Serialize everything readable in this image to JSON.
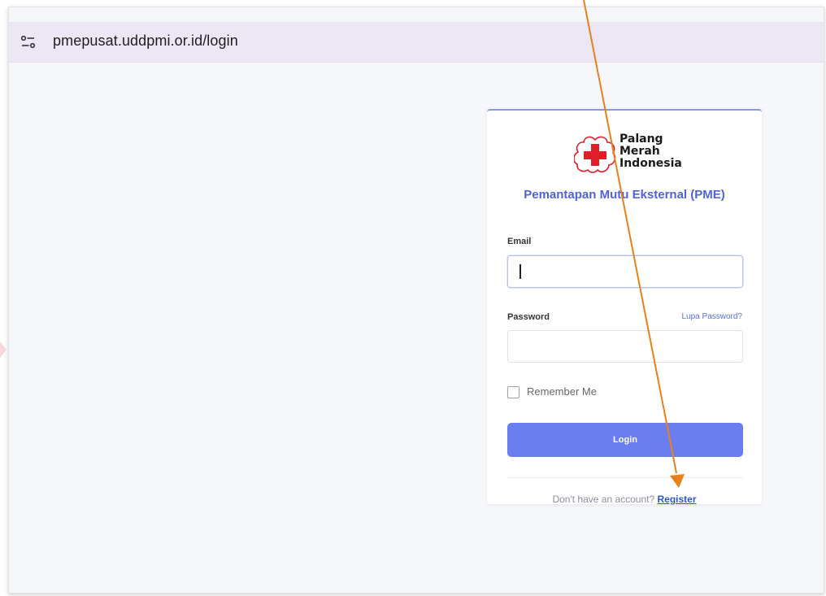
{
  "browser": {
    "url": "pmepusat.uddpmi.or.id/login",
    "icon": "tune-icon"
  },
  "logo": {
    "line1": "Palang",
    "line2": "Merah",
    "line3": "Indonesia",
    "icon": "red-cross-flower-icon",
    "color": "#e11d2a"
  },
  "form": {
    "app_title": "Pemantapan Mutu Eksternal (PME)",
    "email_label": "Email",
    "email_value": "",
    "password_label": "Password",
    "password_value": "",
    "forgot_label": "Lupa Password?",
    "remember_label": "Remember Me",
    "remember_checked": false,
    "login_label": "Login",
    "register_prompt": "Don't have an account? ",
    "register_label": "Register"
  },
  "colors": {
    "accent": "#6b7ef0",
    "title": "#4f63d6",
    "annotation_arrow": "#e8801c",
    "address_bar": "#ede6f4"
  },
  "annotation": {
    "type": "arrow",
    "target": "register-link"
  }
}
